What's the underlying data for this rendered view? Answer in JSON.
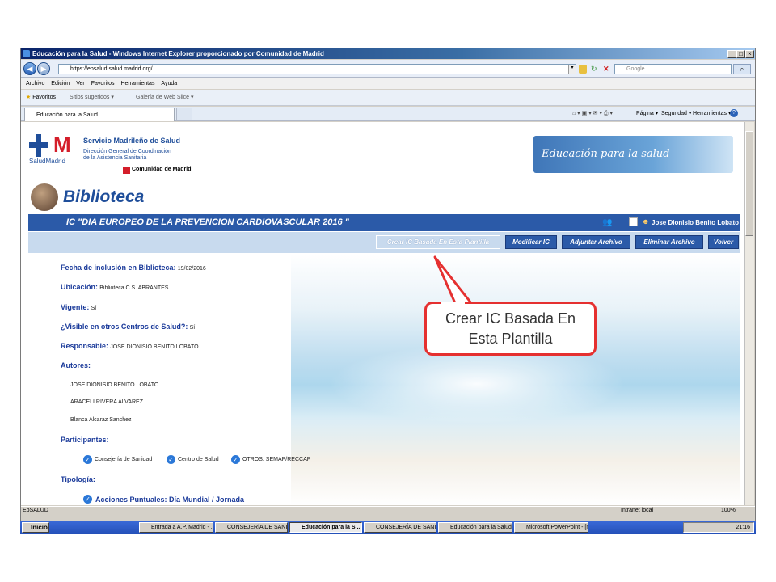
{
  "window": {
    "title": "Educación para la Salud - Windows Internet Explorer proporcionado por Comunidad de Madrid"
  },
  "address": {
    "url": "https://epsalud.salud.madrid.org/",
    "search_placeholder": "Google"
  },
  "menu": [
    "Archivo",
    "Edición",
    "Ver",
    "Favoritos",
    "Herramientas",
    "Ayuda"
  ],
  "favorites": {
    "label": "Favoritos",
    "links": [
      "Sitios sugeridos ▾",
      "Galería de Web Slice ▾"
    ]
  },
  "tab": {
    "label": "Educación para la Salud"
  },
  "command_bar": [
    "Página ▾",
    "Seguridad ▾",
    "Herramientas ▾"
  ],
  "header": {
    "org_name": "Servicio Madrileño de Salud",
    "org_sub1": "Dirección General de Coordinación",
    "org_sub2": "de la Asistencia Sanitaria",
    "logo_caption": "SaludMadrid",
    "comunidad": "Comunidad de Madrid",
    "banner_text": "Educación para la salud"
  },
  "section_title": "Biblioteca",
  "ic_title": "IC \"DIA EUROPEO DE LA PREVENCION CARDIOVASCULAR 2016 \"",
  "user_name": "Jose Dionisio Benito Lobato",
  "actions": [
    "Crear IC Basada En Esta Plantilla",
    "Modificar IC",
    "Adjuntar Archivo",
    "Eliminar Archivo",
    "Volver"
  ],
  "fields": {
    "fecha_label": "Fecha de inclusión en Biblioteca:",
    "fecha_value": "19/02/2016",
    "ubicacion_label": "Ubicación:",
    "ubicacion_value": "Biblioteca C.S. ABRANTES",
    "vigente_label": "Vigente:",
    "vigente_value": "Sí",
    "visible_label": "¿Visible en otros Centros de Salud?:",
    "visible_value": "Sí",
    "responsable_label": "Responsable:",
    "responsable_value": "JOSE DIONISIO BENITO LOBATO",
    "autores_label": "Autores:",
    "autores": [
      "JOSE DIONISIO BENITO LOBATO",
      "ARACELI RIVERA ALVAREZ",
      "Blanca Alcaraz Sanchez"
    ],
    "participantes_label": "Participantes:",
    "participantes": [
      "Consejería de Sanidad",
      "Centro de Salud",
      "OTROS: SEMAP/RECCAP"
    ],
    "tipologia_label": "Tipología:",
    "tipologia_value": "Acciones Puntuales: Día Mundial / Jornada"
  },
  "status": {
    "left": "EpSALUD",
    "zone": "Intranet local",
    "zoom": "100%"
  },
  "taskbar": {
    "start": "Inicio",
    "tasks": [
      "Entrada a A.P. Madrid - ...",
      "CONSEJERÍA DE SANID...",
      "Educación para la S...",
      "CONSEJERÍA DE SANID...",
      "Educación para la Salud -...",
      "Microsoft PowerPoint - [N..."
    ],
    "clock": "21:16"
  },
  "callout": {
    "line1": "Crear IC Basada En",
    "line2": "Esta Plantilla"
  },
  "colors": {
    "brand_blue": "#2b5aa8",
    "callout_red": "#e53030",
    "label_blue": "#1a3a9a"
  }
}
